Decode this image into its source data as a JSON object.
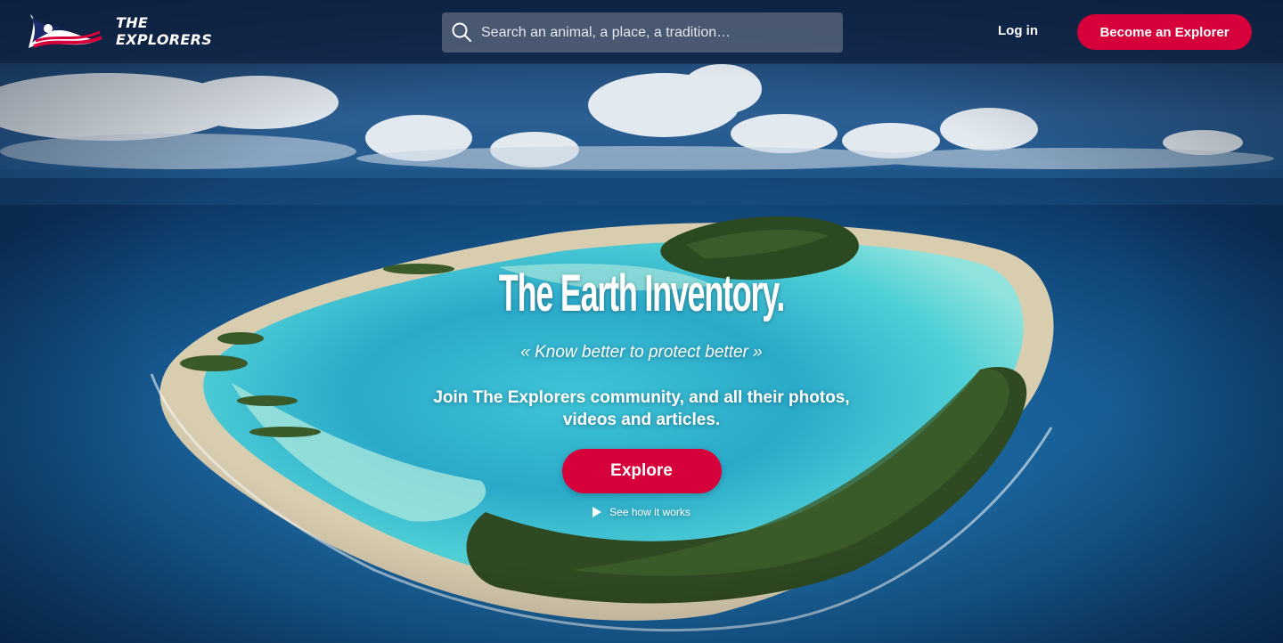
{
  "brand": {
    "name": "THE\nEXPLORERS",
    "logo_icon": "flag-wave-logo-icon",
    "colors": {
      "accent": "#d6003a",
      "navy": "#1b2a6b"
    }
  },
  "header": {
    "search": {
      "icon": "search-icon",
      "placeholder": "Search an animal, a place, a tradition…"
    },
    "login_label": "Log in",
    "become_label": "Become an Explorer"
  },
  "hero": {
    "title": "The Earth Inventory.",
    "tagline": "« Know better to protect better »",
    "text": "Join The Explorers community, and all their photos, videos and articles.",
    "explore_label": "Explore",
    "how_icon": "play-icon",
    "how_label": "See how it works",
    "background": "aerial-atoll-photo"
  }
}
